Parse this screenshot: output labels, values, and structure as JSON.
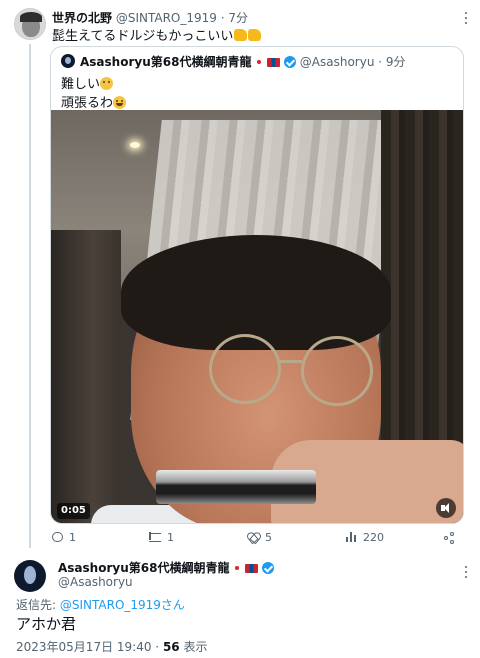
{
  "tweet": {
    "author_name": "世界の北野",
    "author_handle": "@SINTARO_1919",
    "separator": "·",
    "time": "7分",
    "text": "髭生えてるドルジもかっこいい",
    "emoji_icons": [
      "thumbs-up-icon",
      "thumbs-up-icon"
    ]
  },
  "quote": {
    "author_name": "Asashoryu第68代横綱朝青龍",
    "author_handle": "@Asashoryu",
    "separator": "·",
    "time": "9分",
    "line1": "難しい",
    "line1_emoji": "thinking-face-icon",
    "line2": "頑張るわ",
    "line2_emoji": "grinning-face-icon",
    "video": {
      "duration": "0:05",
      "mute_icon": "speaker-muted-icon"
    }
  },
  "actions": {
    "reply_count": "1",
    "retweet_count": "1",
    "like_count": "5",
    "view_count": "220"
  },
  "reply": {
    "author_name": "Asashoryu第68代横綱朝青龍",
    "author_handle": "@Asashoryu",
    "reply_to_label": "返信先: ",
    "reply_to_link": "@SINTARO_1919さん",
    "text": "アホか君",
    "date": "2023年05月17日 19:40",
    "separator": " · ",
    "views": "56",
    "views_label": " 表示"
  },
  "colors": {
    "accent": "#1d9bf0",
    "text": "#0f1419",
    "muted": "#536471",
    "border": "#cfd9de"
  }
}
